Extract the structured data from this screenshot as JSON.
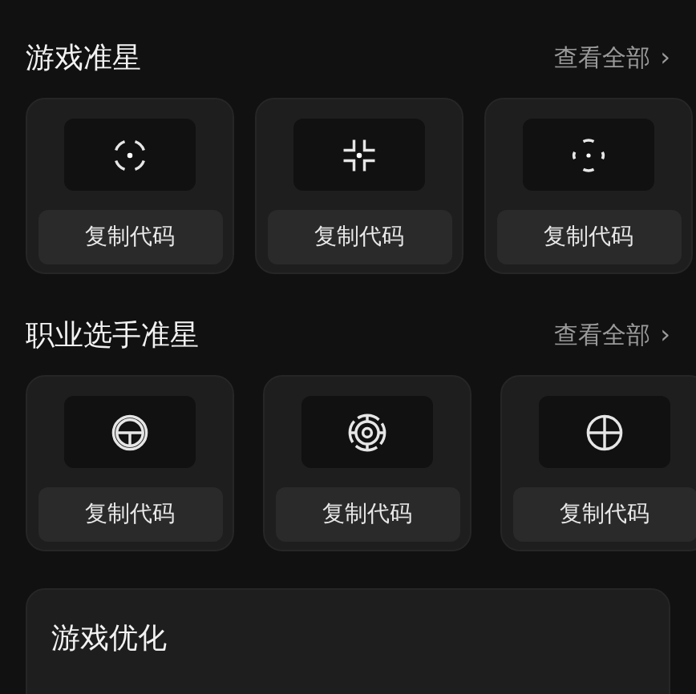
{
  "sections": [
    {
      "title": "游戏准星",
      "link": "查看全部",
      "link_arrow": "›",
      "items": [
        {
          "kind": "arc-dot",
          "button": "复制代码"
        },
        {
          "kind": "corner-dot",
          "button": "复制代码"
        },
        {
          "kind": "bracket-dot",
          "button": "复制代码"
        }
      ]
    },
    {
      "title": "职业选手准星",
      "link": "查看全部",
      "link_arrow": "›",
      "items": [
        {
          "kind": "circle-t",
          "button": "复制代码"
        },
        {
          "kind": "circle-ring",
          "button": "复制代码"
        },
        {
          "kind": "circle-cross",
          "button": "复制代码"
        }
      ]
    }
  ],
  "panel": {
    "title": "游戏优化"
  }
}
